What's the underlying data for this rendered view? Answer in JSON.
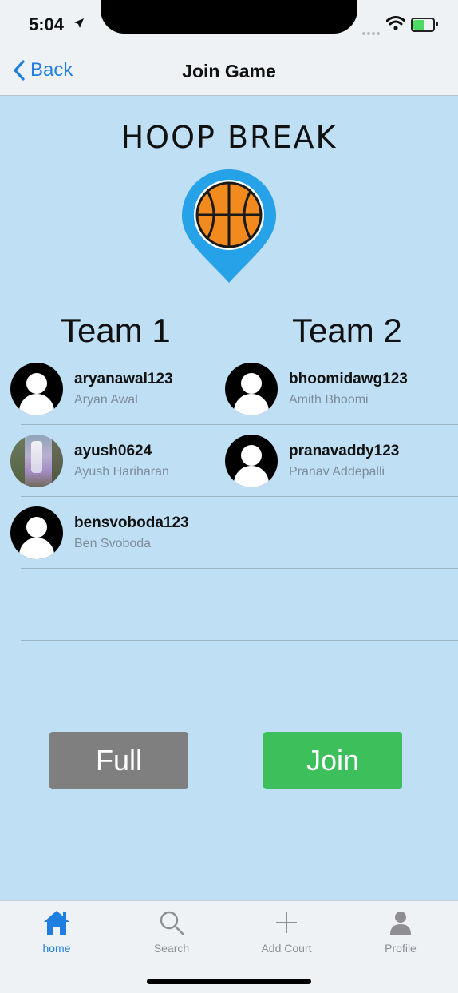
{
  "status_bar": {
    "time": "5:04",
    "battery_level": 0.6,
    "battery_color": "#4cd964"
  },
  "nav": {
    "back_label": "Back",
    "title": "Join Game",
    "accent": "#1e7fe0"
  },
  "brand": {
    "title": "HOOP BREAK",
    "logo_icon": "basketball-pin-icon",
    "pin_color": "#26a2e8",
    "ball_color": "#f28a1e"
  },
  "teams": [
    {
      "header": "Team 1",
      "players": [
        {
          "username": "aryanawal123",
          "full_name": "Aryan Awal",
          "avatar": "default-avatar-icon"
        },
        {
          "username": "ayush0624",
          "full_name": "Ayush Hariharan",
          "avatar": "photo-avatar"
        },
        {
          "username": "bensvoboda123",
          "full_name": "Ben Svoboda",
          "avatar": "default-avatar-icon"
        }
      ]
    },
    {
      "header": "Team 2",
      "players": [
        {
          "username": "bhoomidawg123",
          "full_name": "Amith Bhoomi",
          "avatar": "default-avatar-icon"
        },
        {
          "username": "pranavaddy123",
          "full_name": "Pranav Addepalli",
          "avatar": "default-avatar-icon"
        }
      ]
    }
  ],
  "actions": {
    "full_label": "Full",
    "join_label": "Join",
    "full_color": "#7f7f7f",
    "join_color": "#3dbf5c"
  },
  "tab_bar": {
    "tabs": [
      {
        "label": "home",
        "icon": "home-icon",
        "active": true
      },
      {
        "label": "Search",
        "icon": "search-icon",
        "active": false
      },
      {
        "label": "Add Court",
        "icon": "plus-icon",
        "active": false
      },
      {
        "label": "Profile",
        "icon": "person-icon",
        "active": false
      }
    ]
  },
  "colors": {
    "content_bg": "#bfdff5",
    "chrome_bg": "#eef2f5"
  }
}
